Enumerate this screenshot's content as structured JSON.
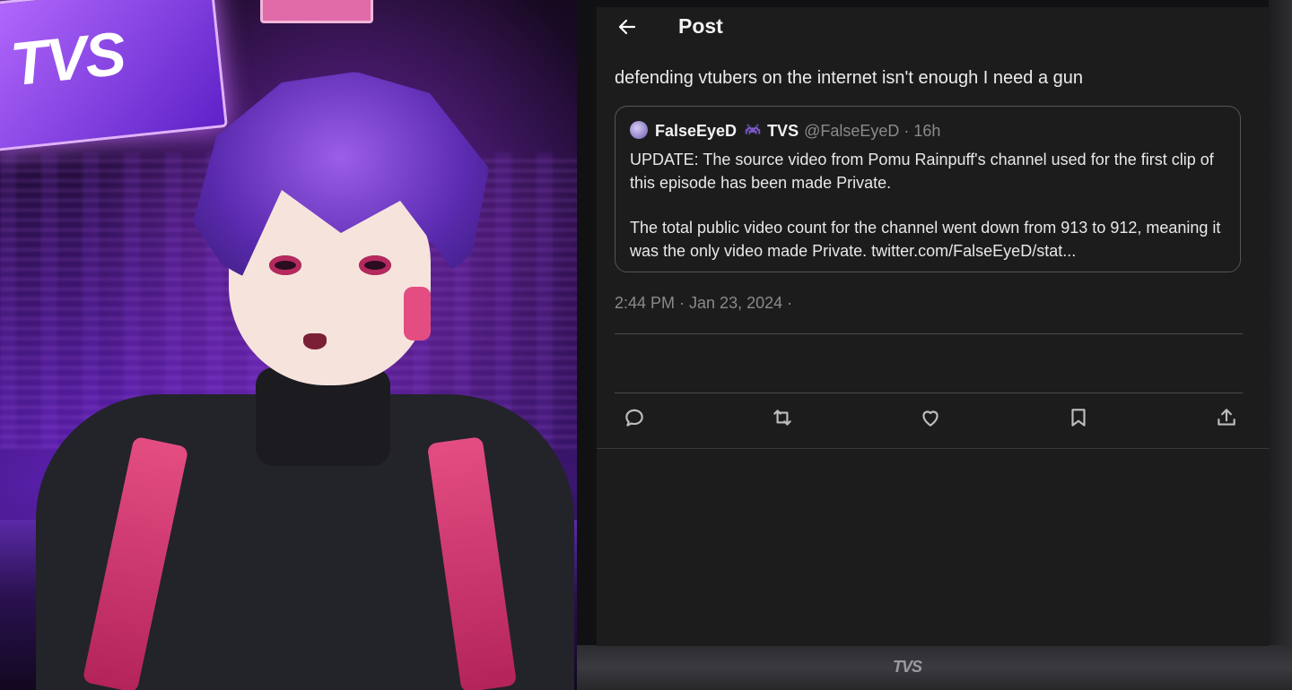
{
  "scene": {
    "sign_text": "TVS"
  },
  "monitor": {
    "brand": "TVS"
  },
  "post": {
    "header_title": "Post",
    "text": "defending vtubers on the internet isn't enough I need a gun",
    "timestamp": "2:44 PM · Jan 23, 2024 ·"
  },
  "quote": {
    "author_name": "FalseEyeD",
    "badge_icon": "space-invader-icon",
    "org": "TVS",
    "handle": "@FalseEyeD",
    "age": "· 16h",
    "paragraph1": "UPDATE: The source video from Pomu Rainpuff's channel used for the first clip of this episode has been made Private.",
    "paragraph2": "The total public video count for the channel went down from 913 to 912, meaning it was the only video made Private. twitter.com/FalseEyeD/stat..."
  },
  "actions": [
    "reply-icon",
    "retweet-icon",
    "like-icon",
    "bookmark-icon",
    "share-icon"
  ],
  "colors": {
    "screen_bg": "#1c1c1c",
    "accent_purple": "#7b58c9",
    "strap_pink": "#e44d82"
  }
}
